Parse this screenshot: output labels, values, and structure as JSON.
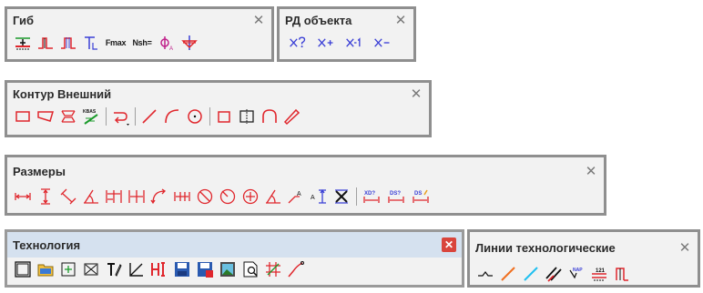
{
  "toolbars": {
    "gib": {
      "title": "Гиб",
      "close": "✕",
      "fmax_label": "Fmax",
      "nsh_label": "Nsh="
    },
    "rd": {
      "title": "РД объекта",
      "close": "✕"
    },
    "kontur": {
      "title": "Контур Внешний",
      "close": "✕",
      "kbas_label": "KBAS"
    },
    "razmery": {
      "title": "Размеры",
      "close": "✕",
      "xd_label": "XD?",
      "ds_label": "DS?",
      "ds2_label": "DS"
    },
    "tehnologia": {
      "title": "Технология",
      "close": "✕"
    },
    "linii": {
      "title": "Линии технологические",
      "close": "✕",
      "nap_label": "NAP",
      "num_label": "121"
    }
  },
  "colors": {
    "icon_red": "#e0262c",
    "icon_blue": "#3a3fd6",
    "icon_dark": "#222222",
    "active_header": "#d5e1ef",
    "close_active": "#d9453c"
  }
}
